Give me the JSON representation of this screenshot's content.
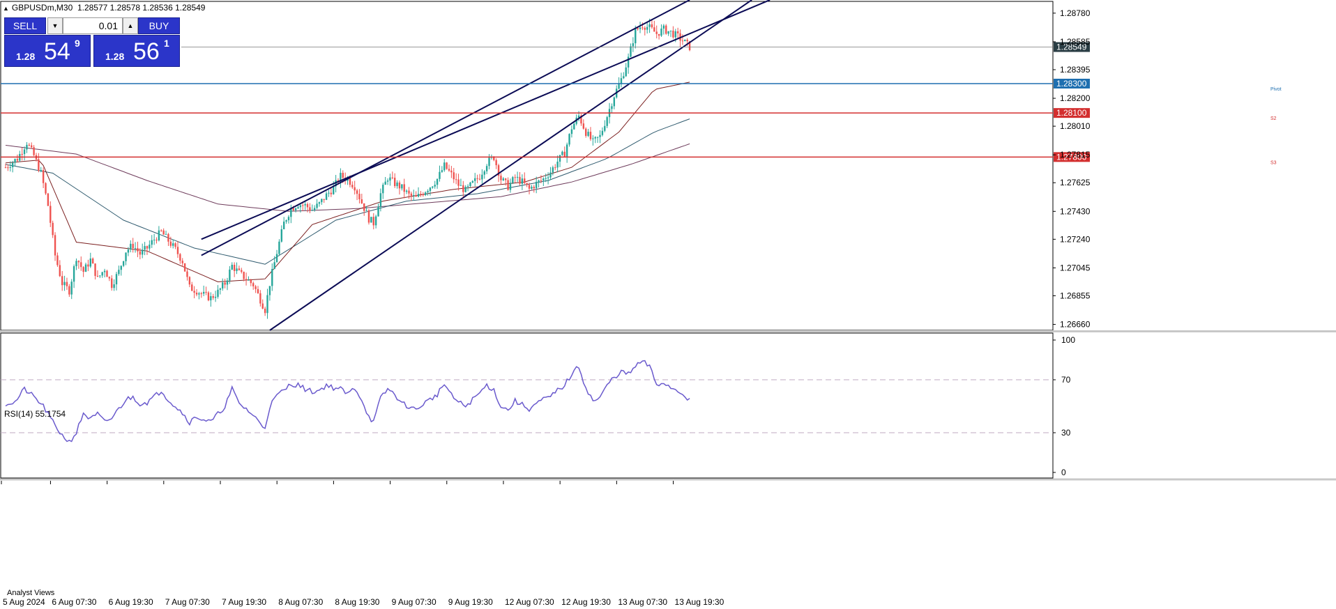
{
  "header": {
    "symbol": "GBPUSDm,M30",
    "ohlc": "1.28577 1.28578 1.28536 1.28549"
  },
  "trade_panel": {
    "sell_label": "SELL",
    "buy_label": "BUY",
    "lot_value": "0.01",
    "sell_price_prefix": "1.28",
    "sell_price_big": "54",
    "sell_price_sup": "9",
    "buy_price_prefix": "1.28",
    "buy_price_big": "56",
    "buy_price_sup": "1"
  },
  "rsi": {
    "label": "RSI(14) 55.1754"
  },
  "bottom_tab": "Analyst Views",
  "colors": {
    "bull": "#26a69a",
    "bear": "#ef5350",
    "channel": "#0b0b55",
    "rsi_line": "#6a5acd",
    "pivot": "#1e6fb0",
    "s_line": "#d32f2f",
    "ma_fast": "#7b1f1f",
    "ma_mid": "#2e5a6e",
    "ma_slow": "#6d3a5a"
  },
  "chart_data": [
    {
      "type": "candlestick",
      "y_ticks": [
        "1.28780",
        "1.28585",
        "1.28395",
        "1.28200",
        "1.28010",
        "1.27815",
        "1.27625",
        "1.27430",
        "1.27240",
        "1.27045",
        "1.26855",
        "1.26660"
      ],
      "ylim": [
        1.2662,
        1.2886
      ],
      "x_ticks": [
        "5 Aug 2024",
        "6 Aug 07:30",
        "6 Aug 19:30",
        "7 Aug 07:30",
        "7 Aug 19:30",
        "8 Aug 07:30",
        "8 Aug 19:30",
        "9 Aug 07:30",
        "9 Aug 19:30",
        "12 Aug 07:30",
        "12 Aug 19:30",
        "13 Aug 07:30",
        "13 Aug 19:30"
      ],
      "current_price": "1.28549",
      "levels": [
        {
          "name": "Pivot",
          "value": "1.28300"
        },
        {
          "name": "S2",
          "value": "1.28100"
        },
        {
          "name": "S3",
          "value": "1.27800"
        }
      ],
      "close_path": [
        [
          0,
          1.2773
        ],
        [
          5,
          1.2779
        ],
        [
          9,
          1.279
        ],
        [
          12,
          1.2781
        ],
        [
          15,
          1.2769
        ],
        [
          18,
          1.2747
        ],
        [
          21,
          1.2713
        ],
        [
          24,
          1.2694
        ],
        [
          27,
          1.2689
        ],
        [
          30,
          1.2712
        ],
        [
          33,
          1.2702
        ],
        [
          36,
          1.271
        ],
        [
          39,
          1.2697
        ],
        [
          42,
          1.2704
        ],
        [
          45,
          1.2693
        ],
        [
          48,
          1.2702
        ],
        [
          51,
          1.2716
        ],
        [
          54,
          1.272
        ],
        [
          57,
          1.2714
        ],
        [
          60,
          1.2718
        ],
        [
          63,
          1.2724
        ],
        [
          66,
          1.2729
        ],
        [
          69,
          1.2723
        ],
        [
          72,
          1.2717
        ],
        [
          75,
          1.2709
        ],
        [
          78,
          1.2691
        ],
        [
          81,
          1.2689
        ],
        [
          84,
          1.2686
        ],
        [
          87,
          1.2684
        ],
        [
          90,
          1.2688
        ],
        [
          93,
          1.2694
        ],
        [
          96,
          1.2706
        ],
        [
          99,
          1.2701
        ],
        [
          102,
          1.2697
        ],
        [
          105,
          1.2693
        ],
        [
          108,
          1.2683
        ],
        [
          110,
          1.2676
        ],
        [
          112,
          1.2694
        ],
        [
          115,
          1.2715
        ],
        [
          118,
          1.2735
        ],
        [
          121,
          1.2745
        ],
        [
          124,
          1.2748
        ],
        [
          127,
          1.2747
        ],
        [
          130,
          1.2744
        ],
        [
          133,
          1.2748
        ],
        [
          136,
          1.2754
        ],
        [
          139,
          1.2759
        ],
        [
          142,
          1.2767
        ],
        [
          145,
          1.2765
        ],
        [
          148,
          1.276
        ],
        [
          151,
          1.2749
        ],
        [
          154,
          1.2738
        ],
        [
          156,
          1.2735
        ],
        [
          159,
          1.2755
        ],
        [
          162,
          1.2766
        ],
        [
          165,
          1.2762
        ],
        [
          168,
          1.2759
        ],
        [
          171,
          1.2754
        ],
        [
          174,
          1.2752
        ],
        [
          177,
          1.2756
        ],
        [
          180,
          1.276
        ],
        [
          183,
          1.2765
        ],
        [
          186,
          1.2774
        ],
        [
          189,
          1.2768
        ],
        [
          192,
          1.2761
        ],
        [
          195,
          1.2757
        ],
        [
          198,
          1.2762
        ],
        [
          201,
          1.2767
        ],
        [
          204,
          1.2776
        ],
        [
          207,
          1.278
        ],
        [
          210,
          1.2765
        ],
        [
          213,
          1.276
        ],
        [
          216,
          1.2766
        ],
        [
          219,
          1.2763
        ],
        [
          222,
          1.2758
        ],
        [
          225,
          1.2762
        ],
        [
          228,
          1.2765
        ],
        [
          231,
          1.277
        ],
        [
          234,
          1.2777
        ],
        [
          237,
          1.2783
        ],
        [
          240,
          1.28
        ],
        [
          243,
          1.2808
        ],
        [
          246,
          1.2797
        ],
        [
          249,
          1.279
        ],
        [
          252,
          1.2794
        ],
        [
          255,
          1.2808
        ],
        [
          258,
          1.2822
        ],
        [
          261,
          1.2833
        ],
        [
          264,
          1.2847
        ],
        [
          267,
          1.2866
        ],
        [
          270,
          1.287
        ],
        [
          273,
          1.2868
        ],
        [
          276,
          1.2864
        ],
        [
          279,
          1.2867
        ],
        [
          282,
          1.2865
        ],
        [
          285,
          1.2862
        ],
        [
          288,
          1.2858
        ],
        [
          290,
          1.2855
        ]
      ],
      "bar_count": 291,
      "ma_fast": [
        [
          0,
          1.2776
        ],
        [
          15,
          1.2778
        ],
        [
          30,
          1.2722
        ],
        [
          60,
          1.2716
        ],
        [
          90,
          1.2695
        ],
        [
          110,
          1.2697
        ],
        [
          130,
          1.2734
        ],
        [
          160,
          1.275
        ],
        [
          190,
          1.2758
        ],
        [
          220,
          1.2763
        ],
        [
          240,
          1.2773
        ],
        [
          260,
          1.2797
        ],
        [
          275,
          1.2826
        ],
        [
          290,
          1.2831
        ]
      ],
      "ma_mid": [
        [
          0,
          1.2775
        ],
        [
          20,
          1.2769
        ],
        [
          50,
          1.2737
        ],
        [
          80,
          1.2718
        ],
        [
          110,
          1.2707
        ],
        [
          140,
          1.2737
        ],
        [
          170,
          1.275
        ],
        [
          200,
          1.2755
        ],
        [
          230,
          1.2764
        ],
        [
          255,
          1.2779
        ],
        [
          275,
          1.2797
        ],
        [
          290,
          1.2806
        ]
      ],
      "ma_slow": [
        [
          0,
          1.2788
        ],
        [
          30,
          1.2782
        ],
        [
          60,
          1.2764
        ],
        [
          90,
          1.2748
        ],
        [
          120,
          1.2743
        ],
        [
          150,
          1.2745
        ],
        [
          180,
          1.2749
        ],
        [
          210,
          1.2753
        ],
        [
          240,
          1.2763
        ],
        [
          265,
          1.2775
        ],
        [
          290,
          1.2789
        ]
      ],
      "channels": [
        [
          [
            83,
            1.2713
          ],
          [
            290,
            1.2887
          ]
        ],
        [
          [
            83,
            1.2724
          ],
          [
            290,
            1.2864
          ]
        ],
        [
          [
            112,
            1.2662
          ],
          [
            290,
            1.2858
          ]
        ]
      ]
    },
    {
      "type": "line",
      "name": "RSI(14)",
      "ylim": [
        0,
        100
      ],
      "y_ticks": [
        "100",
        "70",
        "30",
        "0"
      ],
      "levels": [
        70,
        30
      ],
      "values_path": [
        [
          0,
          52
        ],
        [
          4,
          53
        ],
        [
          8,
          63
        ],
        [
          12,
          57
        ],
        [
          16,
          50
        ],
        [
          20,
          38
        ],
        [
          24,
          28
        ],
        [
          27,
          23
        ],
        [
          30,
          30
        ],
        [
          33,
          45
        ],
        [
          36,
          40
        ],
        [
          39,
          44
        ],
        [
          42,
          38
        ],
        [
          45,
          41
        ],
        [
          48,
          48
        ],
        [
          51,
          55
        ],
        [
          54,
          57
        ],
        [
          57,
          52
        ],
        [
          60,
          53
        ],
        [
          63,
          57
        ],
        [
          66,
          62
        ],
        [
          69,
          55
        ],
        [
          72,
          50
        ],
        [
          75,
          45
        ],
        [
          78,
          38
        ],
        [
          81,
          42
        ],
        [
          84,
          40
        ],
        [
          87,
          38
        ],
        [
          90,
          44
        ],
        [
          93,
          50
        ],
        [
          96,
          63
        ],
        [
          99,
          52
        ],
        [
          102,
          48
        ],
        [
          105,
          43
        ],
        [
          108,
          37
        ],
        [
          110,
          34
        ],
        [
          112,
          50
        ],
        [
          115,
          58
        ],
        [
          118,
          62
        ],
        [
          121,
          67
        ],
        [
          124,
          66
        ],
        [
          127,
          63
        ],
        [
          130,
          61
        ],
        [
          133,
          62
        ],
        [
          136,
          66
        ],
        [
          139,
          64
        ],
        [
          142,
          63
        ],
        [
          145,
          59
        ],
        [
          148,
          64
        ],
        [
          151,
          55
        ],
        [
          154,
          42
        ],
        [
          156,
          38
        ],
        [
          159,
          56
        ],
        [
          162,
          63
        ],
        [
          165,
          59
        ],
        [
          168,
          52
        ],
        [
          171,
          50
        ],
        [
          174,
          47
        ],
        [
          177,
          52
        ],
        [
          180,
          55
        ],
        [
          183,
          59
        ],
        [
          186,
          67
        ],
        [
          189,
          58
        ],
        [
          192,
          53
        ],
        [
          195,
          50
        ],
        [
          198,
          55
        ],
        [
          201,
          60
        ],
        [
          204,
          66
        ],
        [
          207,
          62
        ],
        [
          210,
          50
        ],
        [
          213,
          47
        ],
        [
          216,
          54
        ],
        [
          219,
          51
        ],
        [
          222,
          48
        ],
        [
          225,
          52
        ],
        [
          228,
          55
        ],
        [
          231,
          57
        ],
        [
          234,
          62
        ],
        [
          237,
          66
        ],
        [
          240,
          74
        ],
        [
          243,
          80
        ],
        [
          246,
          64
        ],
        [
          249,
          54
        ],
        [
          252,
          56
        ],
        [
          255,
          66
        ],
        [
          258,
          72
        ],
        [
          261,
          76
        ],
        [
          264,
          74
        ],
        [
          267,
          80
        ],
        [
          270,
          84
        ],
        [
          273,
          80
        ],
        [
          276,
          66
        ],
        [
          279,
          68
        ],
        [
          282,
          64
        ],
        [
          285,
          62
        ],
        [
          288,
          58
        ],
        [
          290,
          55
        ]
      ]
    }
  ]
}
